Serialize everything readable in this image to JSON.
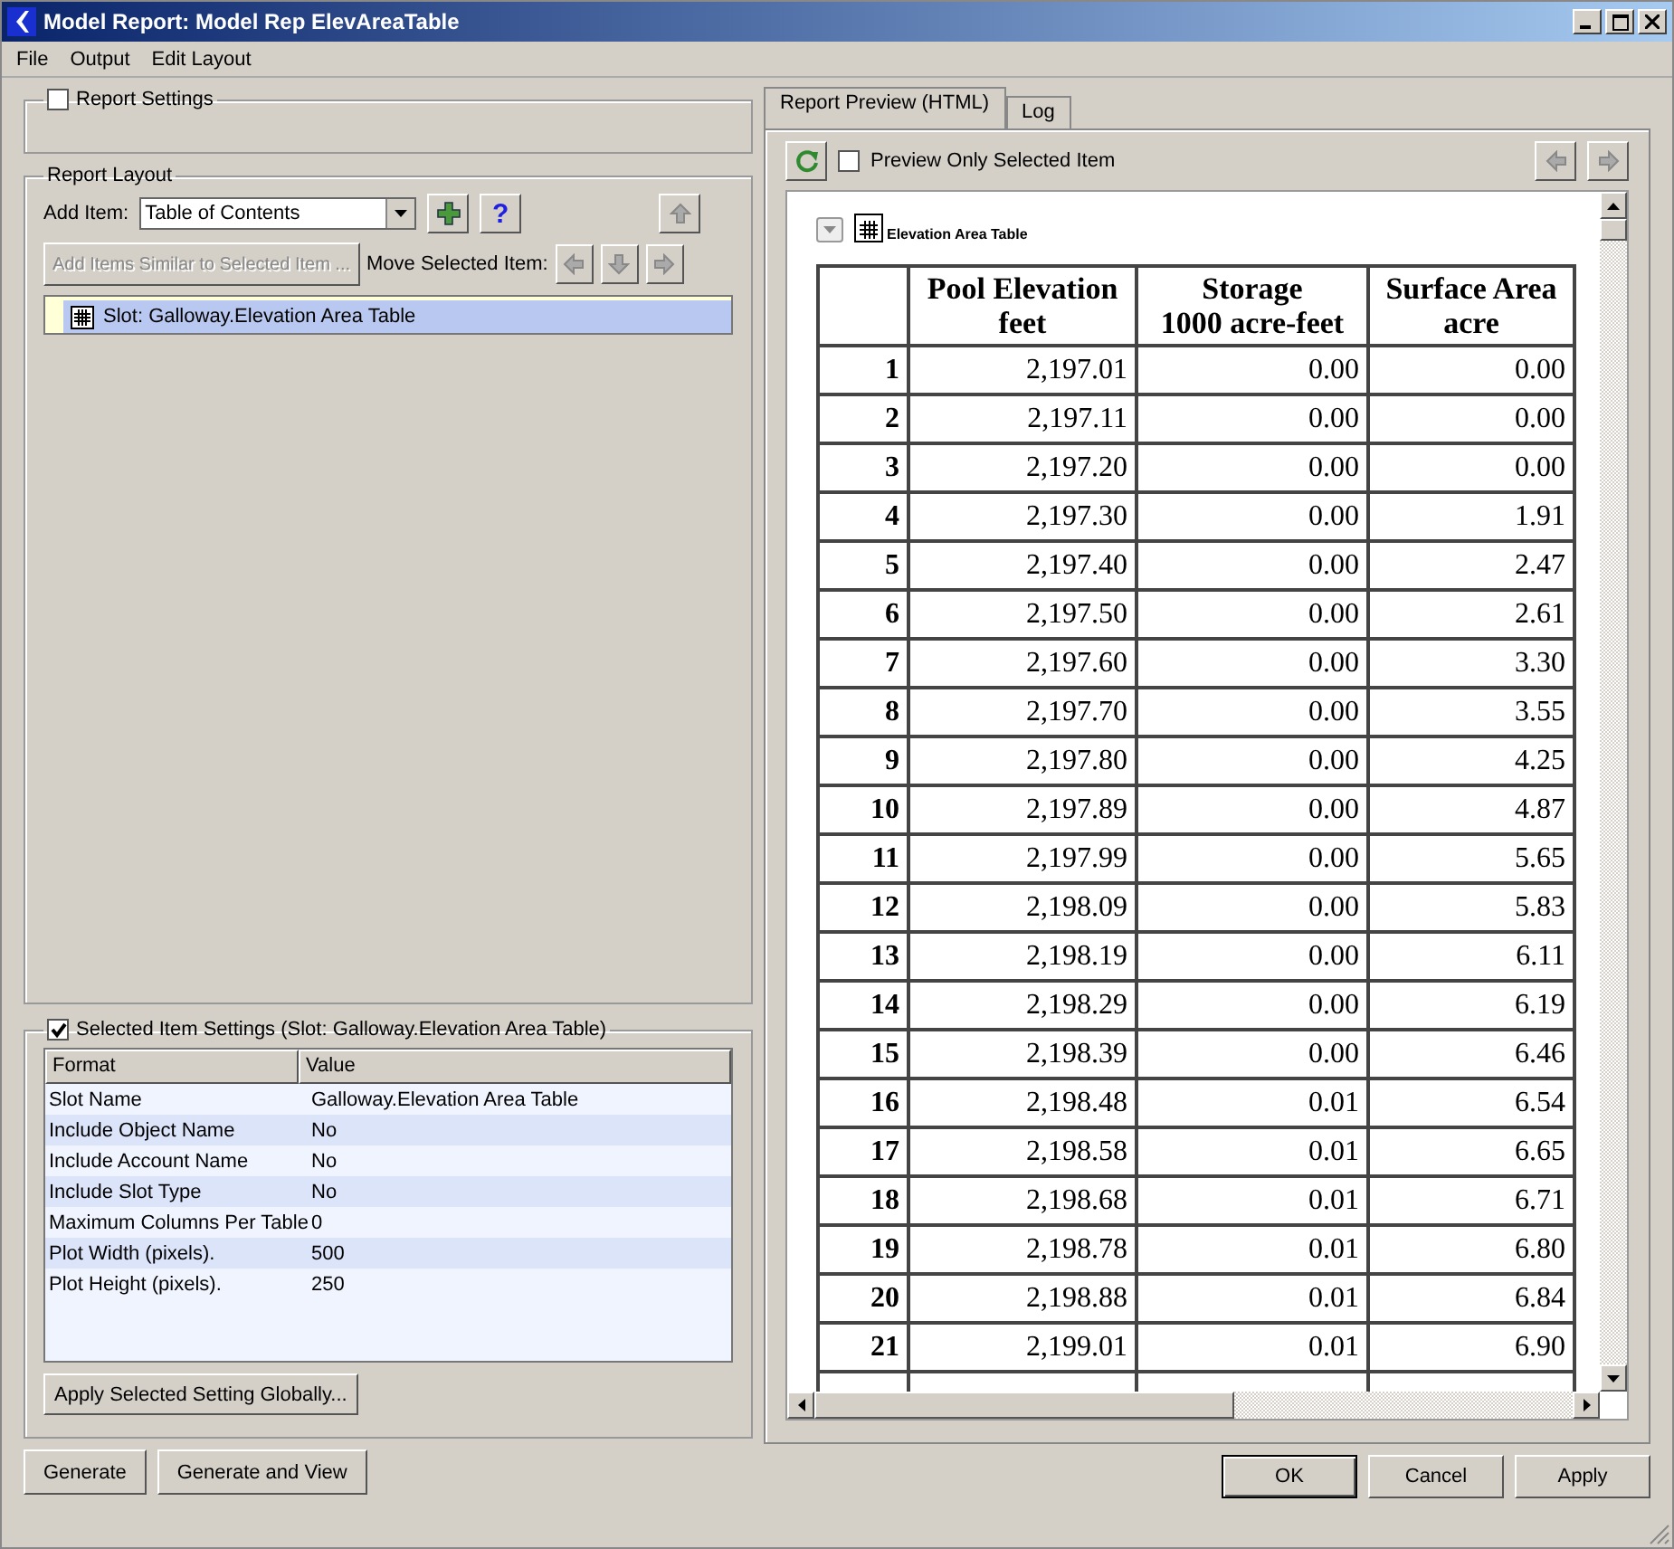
{
  "window": {
    "title": "Model Report: Model Rep ElevAreaTable"
  },
  "menu": [
    "File",
    "Output",
    "Edit Layout"
  ],
  "report_settings": {
    "label": "Report Settings",
    "checked": false
  },
  "report_layout": {
    "title": "Report Layout",
    "add_item_label": "Add Item:",
    "add_item_value": "Table of Contents",
    "add_similar_button": "Add Items Similar to Selected Item ...",
    "add_similar_disabled": true,
    "move_label": "Move Selected Item:",
    "help_label": "?",
    "tree": [
      {
        "label": "Slot: Galloway.Elevation Area Table",
        "selected": true
      }
    ]
  },
  "selected_item_settings": {
    "label": "Selected Item Settings (Slot: Galloway.Elevation Area Table)",
    "checked": true,
    "columns": [
      "Format",
      "Value"
    ],
    "rows": [
      [
        "Slot Name",
        "Galloway.Elevation Area Table"
      ],
      [
        "Include Object Name",
        "No"
      ],
      [
        "Include Account Name",
        "No"
      ],
      [
        "Include Slot Type",
        "No"
      ],
      [
        "Maximum Columns Per Table",
        "0"
      ],
      [
        "Plot Width (pixels).",
        "500"
      ],
      [
        "Plot Height (pixels).",
        "250"
      ]
    ],
    "apply_button": "Apply Selected Setting Globally..."
  },
  "left_buttons": [
    "Generate",
    "Generate and View"
  ],
  "tabs": [
    {
      "label": "Report Preview (HTML)",
      "selected": true
    },
    {
      "label": "Log",
      "selected": false
    }
  ],
  "preview": {
    "only_selected_label": "Preview Only Selected Item",
    "only_selected_checked": false,
    "caption": "Elevation Area Table",
    "columns": [
      "",
      "Pool Elevation\nfeet",
      "Storage\n1000 acre-feet",
      "Surface Area\nacre"
    ],
    "rows": [
      [
        "1",
        "2,197.01",
        "0.00",
        "0.00"
      ],
      [
        "2",
        "2,197.11",
        "0.00",
        "0.00"
      ],
      [
        "3",
        "2,197.20",
        "0.00",
        "0.00"
      ],
      [
        "4",
        "2,197.30",
        "0.00",
        "1.91"
      ],
      [
        "5",
        "2,197.40",
        "0.00",
        "2.47"
      ],
      [
        "6",
        "2,197.50",
        "0.00",
        "2.61"
      ],
      [
        "7",
        "2,197.60",
        "0.00",
        "3.30"
      ],
      [
        "8",
        "2,197.70",
        "0.00",
        "3.55"
      ],
      [
        "9",
        "2,197.80",
        "0.00",
        "4.25"
      ],
      [
        "10",
        "2,197.89",
        "0.00",
        "4.87"
      ],
      [
        "11",
        "2,197.99",
        "0.00",
        "5.65"
      ],
      [
        "12",
        "2,198.09",
        "0.00",
        "5.83"
      ],
      [
        "13",
        "2,198.19",
        "0.00",
        "6.11"
      ],
      [
        "14",
        "2,198.29",
        "0.00",
        "6.19"
      ],
      [
        "15",
        "2,198.39",
        "0.00",
        "6.46"
      ],
      [
        "16",
        "2,198.48",
        "0.01",
        "6.54"
      ],
      [
        "17",
        "2,198.58",
        "0.01",
        "6.65"
      ],
      [
        "18",
        "2,198.68",
        "0.01",
        "6.71"
      ],
      [
        "19",
        "2,198.78",
        "0.01",
        "6.80"
      ],
      [
        "20",
        "2,198.88",
        "0.01",
        "6.84"
      ],
      [
        "21",
        "2,199.01",
        "0.01",
        "6.90"
      ]
    ]
  },
  "dialog_buttons": [
    {
      "label": "OK",
      "default": true
    },
    {
      "label": "Cancel",
      "default": false
    },
    {
      "label": "Apply",
      "default": false
    }
  ]
}
